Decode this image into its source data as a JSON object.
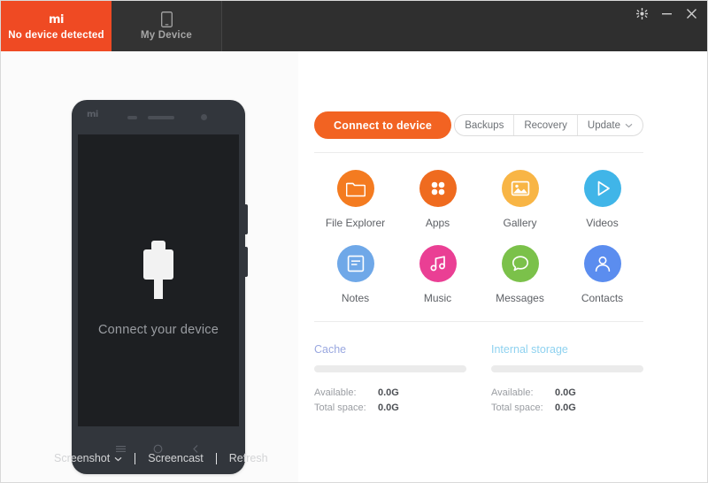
{
  "window": {
    "controls": [
      {
        "name": "settings-gear",
        "glyph": "✲"
      },
      {
        "name": "minimize",
        "glyph": "—"
      },
      {
        "name": "close",
        "glyph": "✕"
      }
    ]
  },
  "tabs": [
    {
      "id": "no-device",
      "logo": "mi",
      "label": "No device detected",
      "active": true,
      "color": "#ef4a23"
    },
    {
      "id": "my-device",
      "icon": "phone-icon",
      "label": "My Device",
      "active": false
    }
  ],
  "phone_preview": {
    "logo": "mi",
    "connect_text": "Connect your device",
    "usb_icon": "usb-connector-icon",
    "nav_buttons": [
      "menu-icon",
      "home-icon",
      "back-icon"
    ]
  },
  "bottom_toolbar": {
    "screenshot": "Screenshot",
    "screencast": "Screencast",
    "refresh": "Refresh"
  },
  "actions": {
    "connect_label": "Connect to device",
    "connect_color": "#f26322",
    "segmented": [
      {
        "label": "Backups",
        "caret": false
      },
      {
        "label": "Recovery",
        "caret": false
      },
      {
        "label": "Update",
        "caret": true
      }
    ]
  },
  "shortcuts": [
    {
      "label": "File Explorer",
      "icon": "folder-icon",
      "color": "#f47b20"
    },
    {
      "label": "Apps",
      "icon": "apps-grid-icon",
      "color": "#ef6b1f"
    },
    {
      "label": "Gallery",
      "icon": "image-icon",
      "color": "#f8b545"
    },
    {
      "label": "Videos",
      "icon": "play-icon",
      "color": "#40b5e8"
    },
    {
      "label": "Notes",
      "icon": "note-icon",
      "color": "#6fa8e8"
    },
    {
      "label": "Music",
      "icon": "music-icon",
      "color": "#ea3f94"
    },
    {
      "label": "Messages",
      "icon": "chat-icon",
      "color": "#7bc14a"
    },
    {
      "label": "Contacts",
      "icon": "person-icon",
      "color": "#5b8def"
    }
  ],
  "storage": {
    "available_label": "Available:",
    "total_label": "Total space:",
    "sections": [
      {
        "title": "Cache",
        "color": "#9aa8e0",
        "available": "0.0G",
        "total": "0.0G",
        "fill_percent": 0
      },
      {
        "title": "Internal storage",
        "color": "#8fd2f0",
        "available": "0.0G",
        "total": "0.0G",
        "fill_percent": 0
      }
    ]
  }
}
